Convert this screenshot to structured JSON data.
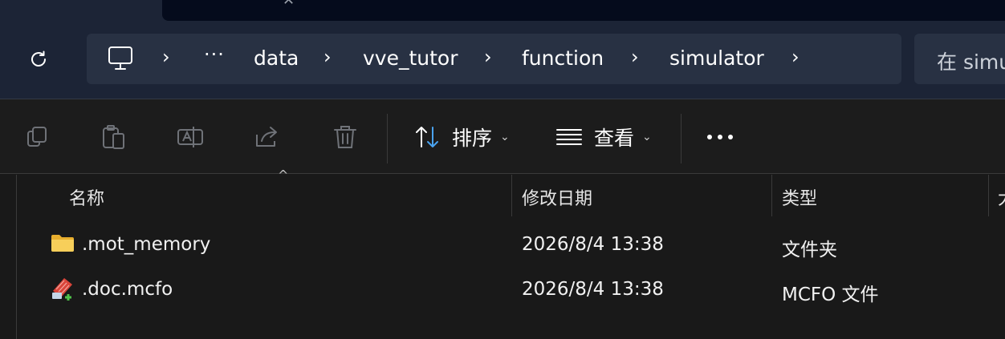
{
  "breadcrumb": [
    "data",
    "vve_tutor",
    "function",
    "simulator"
  ],
  "search": {
    "placeholder": "在 simu"
  },
  "toolbar": {
    "sort_label": "排序",
    "view_label": "查看"
  },
  "columns": {
    "name": "名称",
    "date": "修改日期",
    "type": "类型",
    "size": "大"
  },
  "files": [
    {
      "name": ".mot_memory",
      "date": "2026/8/4 13:38",
      "type": "文件夹",
      "icon": "folder-icon"
    },
    {
      "name": ".doc.mcfo",
      "date": "2026/8/4 13:38",
      "type": "MCFO 文件",
      "icon": "mcfo-file-icon"
    }
  ],
  "colors": {
    "accent": "#1c2436",
    "folder": "#f4c84a"
  }
}
